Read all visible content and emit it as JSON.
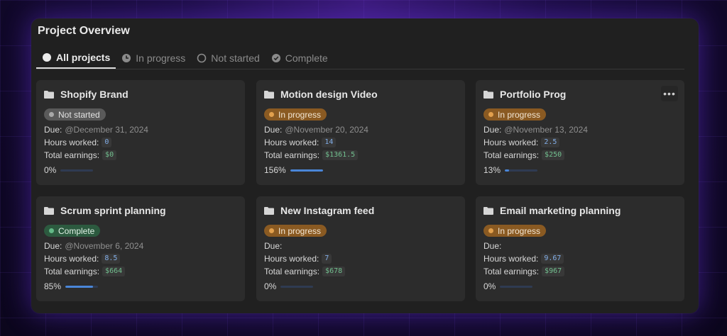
{
  "panel": {
    "title": "Project Overview"
  },
  "tabs": [
    {
      "label": "All projects",
      "icon": "filled-circle-icon",
      "active": true
    },
    {
      "label": "In progress",
      "icon": "clock-icon",
      "active": false
    },
    {
      "label": "Not started",
      "icon": "empty-circle-icon",
      "active": false
    },
    {
      "label": "Complete",
      "icon": "check-circle-icon",
      "active": false
    }
  ],
  "labels": {
    "due": "Due:",
    "hours": "Hours worked:",
    "earnings": "Total earnings:",
    "more": "•••"
  },
  "colors": {
    "accent_blue": "#4a86d8",
    "status_not_started": "#5a5a5a",
    "status_in_progress": "#8a5a22",
    "status_complete": "#2c5a3f"
  },
  "projects": [
    {
      "title": "Shopify Brand",
      "status": "Not started",
      "status_color": "gray",
      "due": "@December 31, 2024",
      "hours": "0",
      "earnings": "$0",
      "progress_label": "0%",
      "progress": 0
    },
    {
      "title": "Motion design Video",
      "status": "In progress",
      "status_color": "orange",
      "due": "@November 20, 2024",
      "hours": "14",
      "earnings": "$1361.5",
      "progress_label": "156%",
      "progress": 1.0
    },
    {
      "title": "Portfolio Prog",
      "status": "In progress",
      "status_color": "orange",
      "due": "@November 13, 2024",
      "hours": "2.5",
      "earnings": "$250",
      "progress_label": "13%",
      "progress": 0.13
    },
    {
      "title": "Scrum sprint planning",
      "status": "Complete",
      "status_color": "green",
      "due": "@November 6, 2024",
      "hours": "8.5",
      "earnings": "$664",
      "progress_label": "85%",
      "progress": 0.85
    },
    {
      "title": "New Instagram feed",
      "status": "In progress",
      "status_color": "orange",
      "due": "",
      "hours": "7",
      "earnings": "$678",
      "progress_label": "0%",
      "progress": 0
    },
    {
      "title": "Email marketing planning",
      "status": "In progress",
      "status_color": "orange",
      "due": "",
      "hours": "9.67",
      "earnings": "$967",
      "progress_label": "0%",
      "progress": 0
    }
  ]
}
